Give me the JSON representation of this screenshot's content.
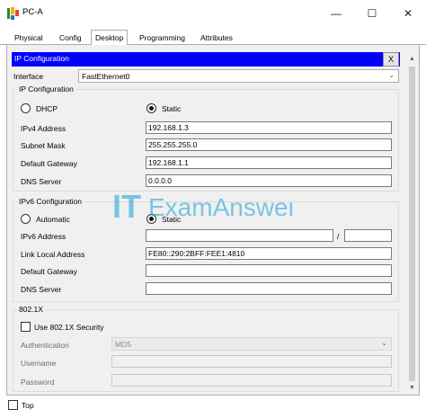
{
  "window": {
    "title": "PC-A",
    "minimize_glyph": "—",
    "maximize_glyph": "☐",
    "close_glyph": "✕"
  },
  "tabs": [
    {
      "label": "Physical",
      "active": false
    },
    {
      "label": "Config",
      "active": false
    },
    {
      "label": "Desktop",
      "active": true
    },
    {
      "label": "Programming",
      "active": false
    },
    {
      "label": "Attributes",
      "active": false
    }
  ],
  "panel": {
    "title": "IP Configuration",
    "close_label": "X"
  },
  "interface": {
    "label": "Interface",
    "value": "FastEthernet0"
  },
  "ipv4": {
    "group_title": "IP Configuration",
    "dhcp_label": "DHCP",
    "static_label": "Static",
    "mode": "Static",
    "address_label": "IPv4 Address",
    "address": "192.168.1.3",
    "mask_label": "Subnet Mask",
    "mask": "255.255.255.0",
    "gateway_label": "Default Gateway",
    "gateway": "192.168.1.1",
    "dns_label": "DNS Server",
    "dns": "0.0.0.0"
  },
  "ipv6": {
    "group_title": "IPv6 Configuration",
    "automatic_label": "Automatic",
    "static_label": "Static",
    "mode": "Static",
    "address_label": "IPv6 Address",
    "address": "",
    "prefix_separator": "/",
    "prefix": "",
    "link_local_label": "Link Local Address",
    "link_local": "FE80::290:2BFF:FEE1:4810",
    "gateway_label": "Default Gateway",
    "gateway": "",
    "dns_label": "DNS Server",
    "dns": ""
  },
  "dot1x": {
    "group_title": "802.1X",
    "use_label": "Use 802.1X Security",
    "use_checked": false,
    "auth_label": "Authentication",
    "auth_value": "MD5",
    "username_label": "Username",
    "username": "",
    "password_label": "Password",
    "password": ""
  },
  "footer": {
    "top_label": "Top",
    "top_checked": false
  },
  "watermark": {
    "text_it": "IT",
    "text_rest": "ExamAnswers",
    "color": "#1a9fd8"
  },
  "colors": {
    "header_bg": "#0000ff",
    "header_fg": "#ffffff",
    "client_bg": "#f0f0f0"
  }
}
